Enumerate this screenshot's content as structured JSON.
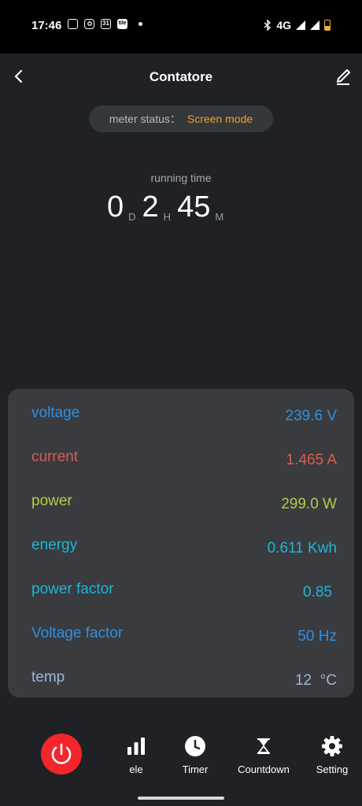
{
  "status_bar": {
    "time": "17:46",
    "notif_icons": [
      "square-outline-icon",
      "instagram-icon",
      "calendar-31-icon",
      "tile-icon"
    ],
    "calendar_day": "31",
    "tile_text": "tile",
    "network": "4G"
  },
  "header": {
    "title": "Contatore"
  },
  "meter_status": {
    "label": "meter status：",
    "value": "Screen mode"
  },
  "running_time": {
    "label": "running time",
    "days": "0",
    "days_unit": "D",
    "hours": "2",
    "hours_unit": "H",
    "minutes": "45",
    "minutes_unit": "M"
  },
  "readings": [
    {
      "label": "voltage",
      "value": "239.6 V",
      "color": "#2f8fe0"
    },
    {
      "label": "current",
      "value": "1.465 A",
      "color": "#dc5d4f"
    },
    {
      "label": "power",
      "value": "299.0 W",
      "color": "#a8d04a"
    },
    {
      "label": "energy",
      "value": "0.611 Kwh",
      "color": "#1fb5d6"
    },
    {
      "label": "power factor",
      "value": "0.85",
      "color": "#1fb5d6"
    },
    {
      "label": "Voltage factor",
      "value": "50 Hz",
      "color": "#2f8fe0"
    },
    {
      "label": "temp",
      "value": "12  °C",
      "color": "#9fb6da"
    }
  ],
  "nav": {
    "power_icon": "power-icon",
    "items": [
      {
        "label": "ele",
        "icon": "bar-chart-icon"
      },
      {
        "label": "Timer",
        "icon": "clock-icon"
      },
      {
        "label": "Countdown",
        "icon": "hourglass-icon"
      },
      {
        "label": "Setting",
        "icon": "gear-icon"
      }
    ]
  },
  "colors": {
    "background": "#1f2124",
    "panel": "#393b3f",
    "accent_orange": "#f4a11d",
    "power_red": "#f2262b"
  }
}
